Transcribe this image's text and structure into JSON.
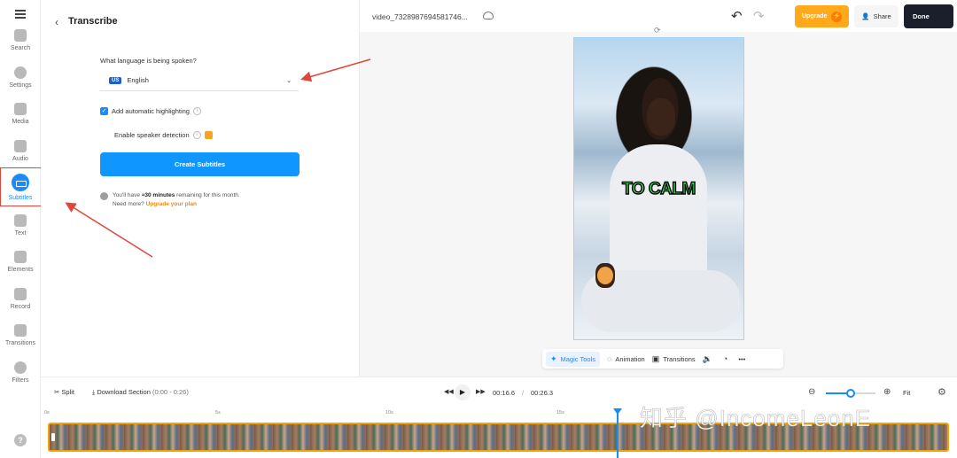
{
  "sidebar": {
    "items": [
      {
        "label": "Search",
        "icon": "search-icon"
      },
      {
        "label": "Settings",
        "icon": "gear-icon"
      },
      {
        "label": "Media",
        "icon": "plus-icon"
      },
      {
        "label": "Audio",
        "icon": "music-note-icon"
      },
      {
        "label": "Subtitles",
        "icon": "subtitles-icon",
        "active": true
      },
      {
        "label": "Text",
        "icon": "text-icon"
      },
      {
        "label": "Elements",
        "icon": "shapes-icon"
      },
      {
        "label": "Record",
        "icon": "record-icon"
      },
      {
        "label": "Transitions",
        "icon": "transitions-icon"
      },
      {
        "label": "Filters",
        "icon": "filters-icon"
      }
    ],
    "help_icon": "?"
  },
  "panel": {
    "back_icon": "‹",
    "title": "Transcribe",
    "language_question": "What language is being spoken?",
    "language_flag": "US",
    "language_value": "English",
    "auto_highlight_label": "Add automatic highlighting",
    "auto_highlight_checked": true,
    "speaker_detection_label": "Enable speaker detection",
    "create_button": "Create Subtitles",
    "quota_prefix": "You'll have",
    "quota_amount": "≈30 minutes",
    "quota_suffix": "remaining for this month.",
    "need_more": "Need more?",
    "upgrade_link": "Upgrade your plan"
  },
  "topbar": {
    "filename": "video_7328987694581746...",
    "upgrade_button": "Upgrade",
    "share_button": "Share",
    "done_button": "Done"
  },
  "canvas": {
    "caption": "TO CALM",
    "caption_color": "#3df25f"
  },
  "canvas_toolbar": {
    "magic_tools": "Magic Tools",
    "animation": "Animation",
    "transitions": "Transitions",
    "more": "•••"
  },
  "timeline": {
    "split": "Split",
    "download_section": "Download Section",
    "download_range": "(0:00 - 0:26)",
    "current_time": "00:16.6",
    "separator": "/",
    "total_time": "00:26.3",
    "fit": "Fit",
    "zoom_level": 0.5,
    "ruler_ticks": [
      "0s",
      "5s",
      "10s",
      "15s"
    ]
  },
  "watermark": "知乎 @IncomeLeonE",
  "colors": {
    "accent": "#1b8cf5",
    "upgrade": "#ffa91b",
    "done": "#1a1f2b",
    "annotation": "#e0463c"
  }
}
